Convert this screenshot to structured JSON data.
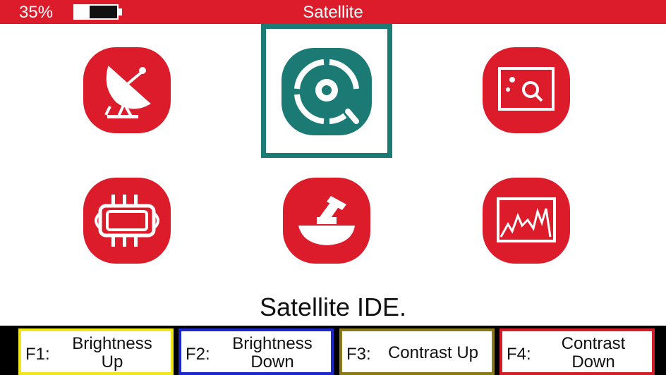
{
  "status_bar": {
    "battery_percent": "35%",
    "battery_level": 0.35,
    "title": "Satellite"
  },
  "tiles": [
    {
      "name": "satellite-dish",
      "icon": "satellite-dish-icon",
      "selected": false
    },
    {
      "name": "satellite-ide",
      "icon": "target-search-icon",
      "selected": true
    },
    {
      "name": "spectrum-search",
      "icon": "search-screen-icon",
      "selected": false
    },
    {
      "name": "lnb-power",
      "icon": "chip-icon",
      "selected": false
    },
    {
      "name": "lnb",
      "icon": "lnb-feed-icon",
      "selected": false
    },
    {
      "name": "spectrum",
      "icon": "spectrum-graph-icon",
      "selected": false
    }
  ],
  "caption": "Satellite IDE.",
  "function_keys": [
    {
      "id": "F1:",
      "label": "Brightness\nUp",
      "color": "#f0e61e"
    },
    {
      "id": "F2:",
      "label": "Brightness\nDown",
      "color": "#1e28c8"
    },
    {
      "id": "F3:",
      "label": "Contrast Up",
      "color": "#8a7a1a"
    },
    {
      "id": "F4:",
      "label": "Contrast\nDown",
      "color": "#d21e28"
    }
  ],
  "colors": {
    "brand_red": "#dc1c2a",
    "selected_teal": "#1b7a74"
  }
}
